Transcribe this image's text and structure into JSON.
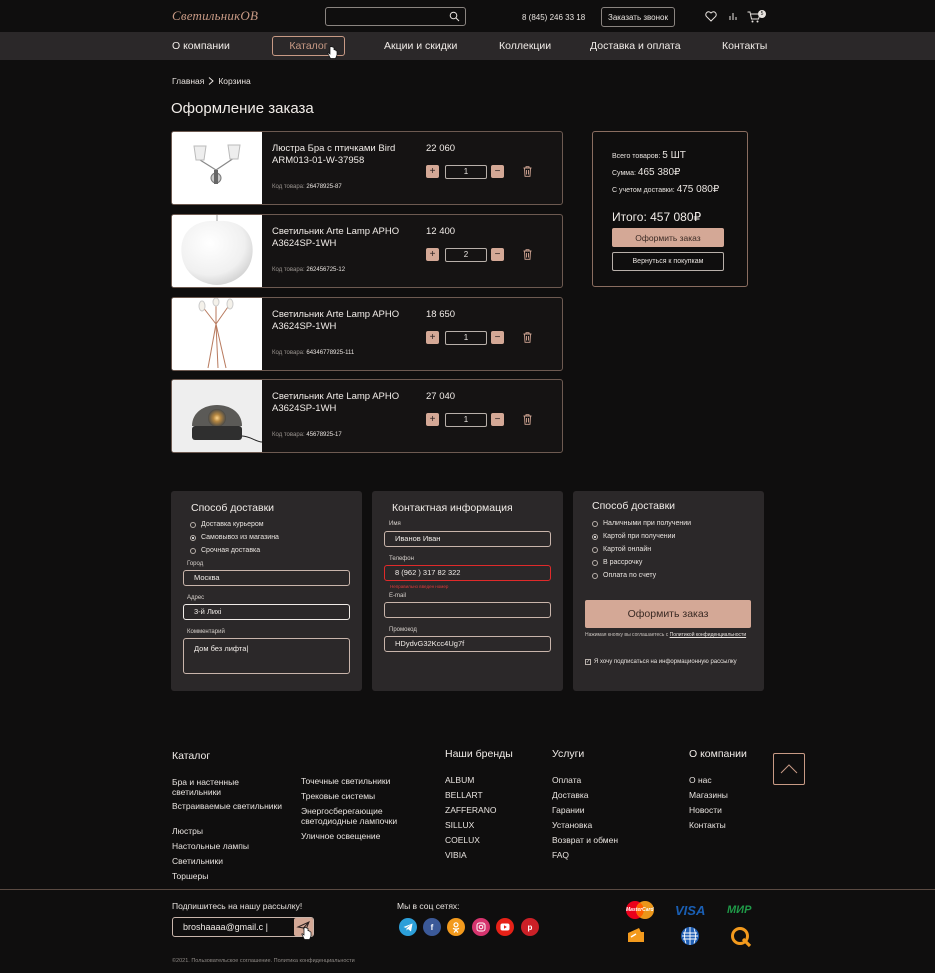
{
  "header": {
    "logo": "СветильникОВ",
    "phone": "8 (845) 246 33 18",
    "call_button": "Заказать звонок",
    "cart_count": "5"
  },
  "nav": [
    "О компании",
    "Каталог",
    "Акции и скидки",
    "Коллекции",
    "Доставка и оплата",
    "Контакты"
  ],
  "breadcrumbs": [
    "Главная",
    "Корзина"
  ],
  "page_title": "Оформление заказа",
  "cart_items": [
    {
      "name": "Люстра Бра с птичками Bird ARM013-01-W-37958",
      "code_label": "Код товара:",
      "code": "26478925-87",
      "price": "22 060",
      "qty": "1"
    },
    {
      "name": "Светильник Arte Lamp APHO A3624SP-1WH",
      "code_label": "Код товара:",
      "code": "262456725-12",
      "price": "12 400",
      "qty": "2"
    },
    {
      "name": "Светильник Arte Lamp APHO A3624SP-1WH",
      "code_label": "Код товара:",
      "code": "64346778925-111",
      "price": "18 650",
      "qty": "1"
    },
    {
      "name": "Светильник Arte Lamp APHO A3624SP-1WH",
      "code_label": "Код товара:",
      "code": "45678925-17",
      "price": "27 040",
      "qty": "1"
    }
  ],
  "summary": {
    "count_label": "Всего товаров:",
    "count_value": "5 ШТ",
    "sum_label": "Сумма:",
    "sum_value": "465 380₽",
    "delivery_label": "С учетом доставки:",
    "delivery_value": "475 080₽",
    "total": "Итого: 457 080₽",
    "order_button": "Оформить заказ",
    "back_button": "Вернуться к покупкам"
  },
  "delivery_form": {
    "title": "Способ доставки",
    "options": [
      "Доставка курьером",
      "Самовывоз из магазина",
      "Срочная доставка"
    ],
    "selected": 1,
    "city_label": "Город",
    "city_value": "Москва",
    "address_label": "Адрес",
    "address_value": "3-й Лихі",
    "comment_label": "Комментарий",
    "comment_value": "Дом без лифта|"
  },
  "contact_form": {
    "title": "Контактная информация",
    "name_label": "Имя",
    "name_value": "Иванов Иван",
    "phone_label": "Телефон",
    "phone_value": "8 (962 ) 317 82 322",
    "phone_error": "Неправильно введен номер",
    "email_label": "E-mail",
    "email_value": "",
    "promo_label": "Промокод",
    "promo_value": "HDydvG32Kcc4Ug7f"
  },
  "payment_form": {
    "title": "Способ доставки",
    "options": [
      "Наличными при получении",
      "Картой при получении",
      "Картой онлайн",
      "В рассрочку",
      "Оплата по счету"
    ],
    "selected": 1,
    "order_button": "Оформить заказ",
    "agree_text": "Нажимая кнопку вы соглашаетесь  с",
    "agree_link": "Политикой конфиденциальности",
    "subscribe_text": "Я хочу подписаться на информационную рассылку"
  },
  "footer": {
    "catalog_title": "Каталог",
    "catalog_col1": [
      "Бра и настенные светильники",
      "Встраиваемые светильники",
      "Люстры",
      "Настольные лампы",
      "Светильники",
      "Торшеры"
    ],
    "catalog_col2": [
      "Точечные светильники",
      "Трековые системы",
      "Энергосберегающие светодиодные лампочки",
      "Уличное освещение"
    ],
    "brands_title": "Наши бренды",
    "brands": [
      "ALBUM",
      "BELLART",
      "ZAFFERANO",
      "SILLUX",
      "COELUX",
      "VIBIA"
    ],
    "services_title": "Услуги",
    "services": [
      "Оплата",
      "Доставка",
      "Гарании",
      "Установка",
      "Возврат и обмен",
      "FAQ"
    ],
    "company_title": "О компании",
    "company": [
      "О нас",
      "Магазины",
      "Новости",
      "Контакты"
    ],
    "subscribe_title": "Подпишитесь на нашу рассылку!",
    "email_value": "broshaaaa@gmail.c |",
    "social_title": "Мы в соц сетях:",
    "copyright": "©2021. Пользовательское соглашение. Политика конфиденциальности",
    "payments": [
      "MasterCard",
      "VISA",
      "МИР"
    ]
  }
}
